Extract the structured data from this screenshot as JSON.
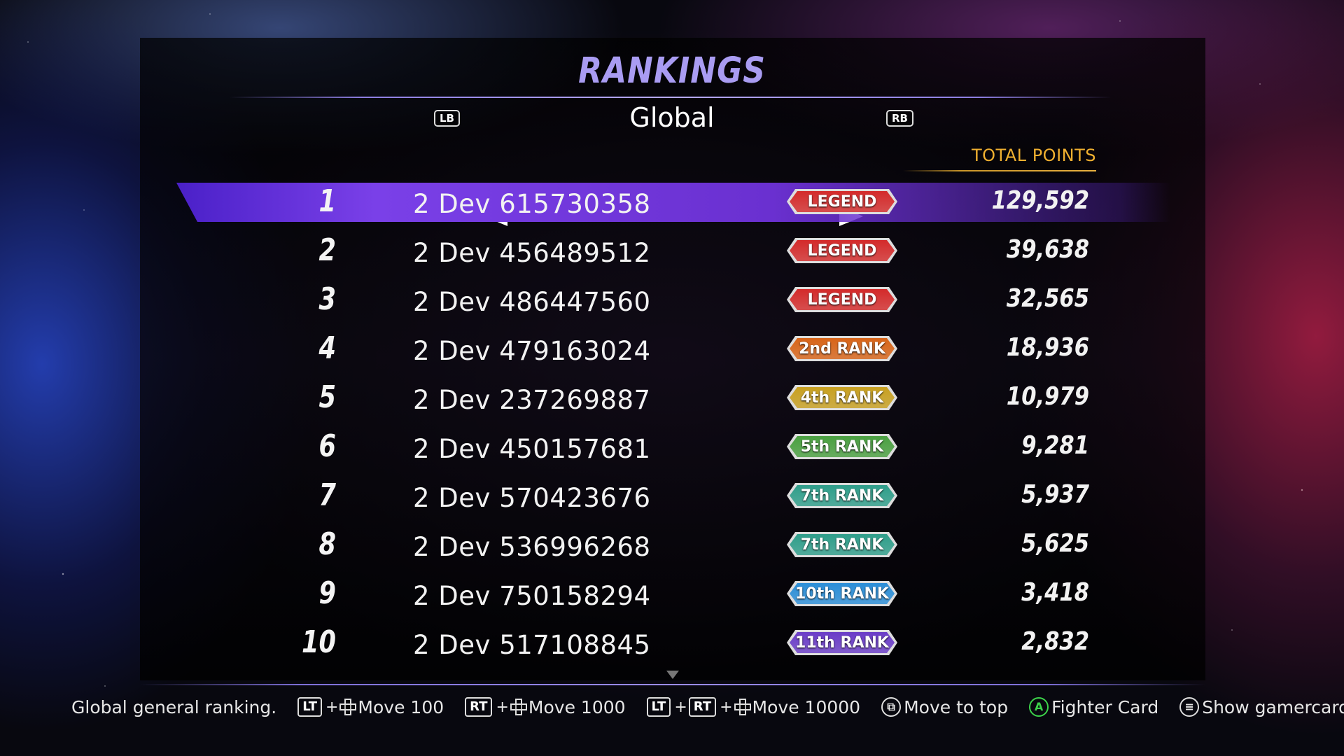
{
  "header": {
    "title": "RANKINGS",
    "category": "Global",
    "prev_button": "LB",
    "next_button": "RB",
    "points_column": "TOTAL POINTS"
  },
  "rankings": [
    {
      "rank": "1",
      "player": "2 Dev 615730358",
      "tier": "LEGEND",
      "points": "129,592",
      "tier_color": "#d42a2a"
    },
    {
      "rank": "2",
      "player": "2 Dev 456489512",
      "tier": "LEGEND",
      "points": "39,638",
      "tier_color": "#d42a2a"
    },
    {
      "rank": "3",
      "player": "2 Dev 486447560",
      "tier": "LEGEND",
      "points": "32,565",
      "tier_color": "#d42a2a"
    },
    {
      "rank": "4",
      "player": "2 Dev 479163024",
      "tier": "2nd RANK",
      "points": "18,936",
      "tier_color": "#d86418"
    },
    {
      "rank": "5",
      "player": "2 Dev 237269887",
      "tier": "4th RANK",
      "points": "10,979",
      "tier_color": "#c8a020"
    },
    {
      "rank": "6",
      "player": "2 Dev 450157681",
      "tier": "5th RANK",
      "points": "9,281",
      "tier_color": "#4aa040"
    },
    {
      "rank": "7",
      "player": "2 Dev 570423676",
      "tier": "7th RANK",
      "points": "5,937",
      "tier_color": "#2e9e8a"
    },
    {
      "rank": "8",
      "player": "2 Dev 536996268",
      "tier": "7th RANK",
      "points": "5,625",
      "tier_color": "#2e9e8a"
    },
    {
      "rank": "9",
      "player": "2 Dev 750158294",
      "tier": "10th RANK",
      "points": "3,418",
      "tier_color": "#2a8ed8"
    },
    {
      "rank": "10",
      "player": "2 Dev 517108845",
      "tier": "11th RANK",
      "points": "2,832",
      "tier_color": "#6a3cc8"
    }
  ],
  "selected_index": 0,
  "footer": {
    "description": "Global general ranking.",
    "lt": "LT",
    "rt": "RT",
    "plus": "+",
    "move_100": "Move 100",
    "move_1000": "Move 1000",
    "move_10000": "Move 10000",
    "move_to_top": "Move to top",
    "a_button": "A",
    "fighter_card": "Fighter Card",
    "show_gamercard": "Show gamercard"
  },
  "icons": {
    "prev": "left-triangle-icon",
    "next": "right-triangle-icon",
    "scroll": "scroll-down-icon",
    "dpad": "dpad-icon",
    "view": "view-button-icon",
    "menu": "menu-button-icon"
  }
}
